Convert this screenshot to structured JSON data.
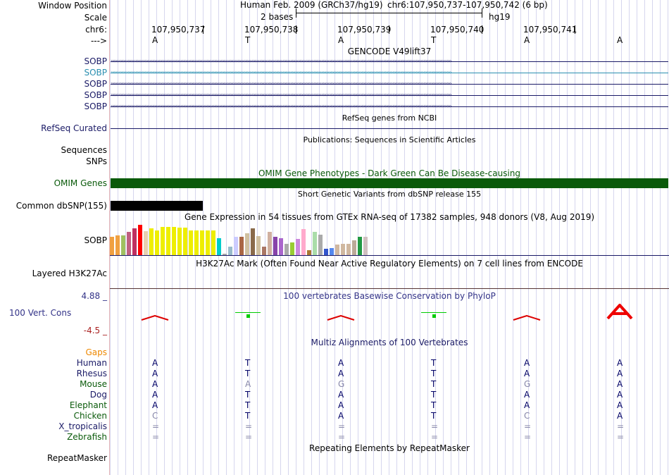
{
  "header": {
    "window_position_label": "Window Position",
    "scale_label": "Scale",
    "chrom_label": "chr6:",
    "strand_label": "--->",
    "assembly": "Human Feb. 2009 (GRCh37/hg19)",
    "position": "chr6:107,950,737-107,950,742 (6 bp)",
    "scale_text": "2 bases",
    "scale_db": "hg19",
    "coordinates": [
      "107,950,737",
      "107,950,738",
      "107,950,739",
      "107,950,740",
      "107,950,741"
    ],
    "bases": [
      "A",
      "T",
      "A",
      "T",
      "A",
      "A"
    ]
  },
  "tracks": {
    "gencode_title": "GENCODE V49lift37",
    "gencode_items": [
      "SOBP",
      "SOBP",
      "SOBP",
      "SOBP",
      "SOBP"
    ],
    "refseq_title": "RefSeq genes from NCBI",
    "refseq_label": "RefSeq Curated",
    "publications_title": "Publications: Sequences in Scientific Articles",
    "sequences_label": "Sequences",
    "snps_label": "SNPs",
    "omim_title": "OMIM Gene Phenotypes - Dark Green Can Be Disease-causing",
    "omim_label": "OMIM Genes",
    "dbsnp_title": "Short Genetic Variants from dbSNP release 155",
    "dbsnp_label": "Common dbSNP(155)",
    "gtex_title": "Gene Expression in 54 tissues from GTEx RNA-seq of 17382 samples, 948 donors (V8, Aug 2019)",
    "gtex_label": "SOBP",
    "h3k27ac_title": "H3K27Ac Mark (Often Found Near Active Regulatory Elements) on 7 cell lines from ENCODE",
    "h3k27ac_label": "Layered H3K27Ac",
    "cons_title": "100 vertebrates Basewise Conservation by PhyloP",
    "cons_label": "100 Vert. Cons",
    "cons_max": "4.88 _",
    "cons_min": "-4.5 _",
    "multiz_title": "Multiz Alignments of 100 Vertebrates",
    "gaps_label": "Gaps",
    "repeat_title": "Repeating Elements by RepeatMasker",
    "repeat_label": "RepeatMasker"
  },
  "gtex_values": [
    {
      "color": "#f0a040",
      "v": 0.55
    },
    {
      "color": "#f0a040",
      "v": 0.6
    },
    {
      "color": "#a0c060",
      "v": 0.6
    },
    {
      "color": "#c06080",
      "v": 0.7
    },
    {
      "color": "#c03060",
      "v": 0.8
    },
    {
      "color": "#ff0000",
      "v": 0.92
    },
    {
      "color": "#e8d0b0",
      "v": 0.72
    },
    {
      "color": "#eeee00",
      "v": 0.8
    },
    {
      "color": "#eeee00",
      "v": 0.75
    },
    {
      "color": "#eeee00",
      "v": 0.85
    },
    {
      "color": "#eeee00",
      "v": 0.85
    },
    {
      "color": "#eeee00",
      "v": 0.85
    },
    {
      "color": "#eeee00",
      "v": 0.82
    },
    {
      "color": "#eeee00",
      "v": 0.82
    },
    {
      "color": "#eeee00",
      "v": 0.75
    },
    {
      "color": "#eeee00",
      "v": 0.75
    },
    {
      "color": "#eeee00",
      "v": 0.75
    },
    {
      "color": "#eeee00",
      "v": 0.75
    },
    {
      "color": "#eeee00",
      "v": 0.75
    },
    {
      "color": "#00cccc",
      "v": 0.5
    },
    {
      "color": "#aaaaaa",
      "v": 0.05
    },
    {
      "color": "#99bbcc",
      "v": 0.25
    },
    {
      "color": "#ccccff",
      "v": 0.55
    },
    {
      "color": "#aa6644",
      "v": 0.55
    },
    {
      "color": "#d0c0a0",
      "v": 0.65
    },
    {
      "color": "#8a6a4a",
      "v": 0.8
    },
    {
      "color": "#d0c0a0",
      "v": 0.58
    },
    {
      "color": "#aa7766",
      "v": 0.25
    },
    {
      "color": "#d0b0a0",
      "v": 0.7
    },
    {
      "color": "#8844aa",
      "v": 0.55
    },
    {
      "color": "#aa66cc",
      "v": 0.5
    },
    {
      "color": "#aaaaaa",
      "v": 0.35
    },
    {
      "color": "#99cc33",
      "v": 0.38
    },
    {
      "color": "#cc88dd",
      "v": 0.48
    },
    {
      "color": "#ffaacc",
      "v": 0.78
    },
    {
      "color": "#aa7733",
      "v": 0.15
    },
    {
      "color": "#aaddaa",
      "v": 0.7
    },
    {
      "color": "#aaaaaa",
      "v": 0.62
    },
    {
      "color": "#3355cc",
      "v": 0.2
    },
    {
      "color": "#5588ee",
      "v": 0.22
    },
    {
      "color": "#d0b8a0",
      "v": 0.32
    },
    {
      "color": "#d0b8a0",
      "v": 0.35
    },
    {
      "color": "#d0b8a0",
      "v": 0.35
    },
    {
      "color": "#bbaa99",
      "v": 0.45
    },
    {
      "color": "#229944",
      "v": 0.55
    },
    {
      "color": "#d0c0c0",
      "v": 0.55
    }
  ],
  "phylop": [
    {
      "type": "chevron",
      "color": "#dd0000"
    },
    {
      "type": "tick",
      "color": "#00cc00"
    },
    {
      "type": "chevron",
      "color": "#dd0000"
    },
    {
      "type": "tick",
      "color": "#00cc00"
    },
    {
      "type": "chevron",
      "color": "#dd0000"
    },
    {
      "type": "big-A",
      "color": "#ee0000"
    }
  ],
  "multiz": {
    "species": [
      {
        "name": "Human",
        "color": "#1a1a66",
        "bases": [
          "A",
          "T",
          "A",
          "T",
          "A",
          "A"
        ]
      },
      {
        "name": "Rhesus",
        "color": "#1a1a66",
        "bases": [
          "A",
          "T",
          "A",
          "T",
          "A",
          "A"
        ]
      },
      {
        "name": "Mouse",
        "color": "#0a5a0a",
        "bases": [
          "A",
          "A",
          "G",
          "T",
          "G",
          "A"
        ]
      },
      {
        "name": "Dog",
        "color": "#1a1a66",
        "bases": [
          "A",
          "T",
          "A",
          "T",
          "A",
          "A"
        ]
      },
      {
        "name": "Elephant",
        "color": "#0a5a0a",
        "bases": [
          "A",
          "T",
          "A",
          "T",
          "A",
          "A"
        ]
      },
      {
        "name": "Chicken",
        "color": "#0a5a0a",
        "bases": [
          "C",
          "T",
          "A",
          "T",
          "C",
          "A"
        ]
      },
      {
        "name": "X_tropicalis",
        "color": "#1a1a66",
        "bases": [
          "=",
          "=",
          "=",
          "=",
          "=",
          "="
        ]
      },
      {
        "name": "Zebrafish",
        "color": "#0a5a0a",
        "bases": [
          "=",
          "=",
          "=",
          "=",
          "=",
          "="
        ]
      }
    ],
    "mismatch_color": "#8888aa",
    "match_color": "#000066"
  },
  "colors": {
    "gencode": "#1a1a66",
    "gencode_alt": "#2a8fb0",
    "omim": "#0a5a0a",
    "gaps": "#ee8800",
    "cons_title": "#333388"
  }
}
